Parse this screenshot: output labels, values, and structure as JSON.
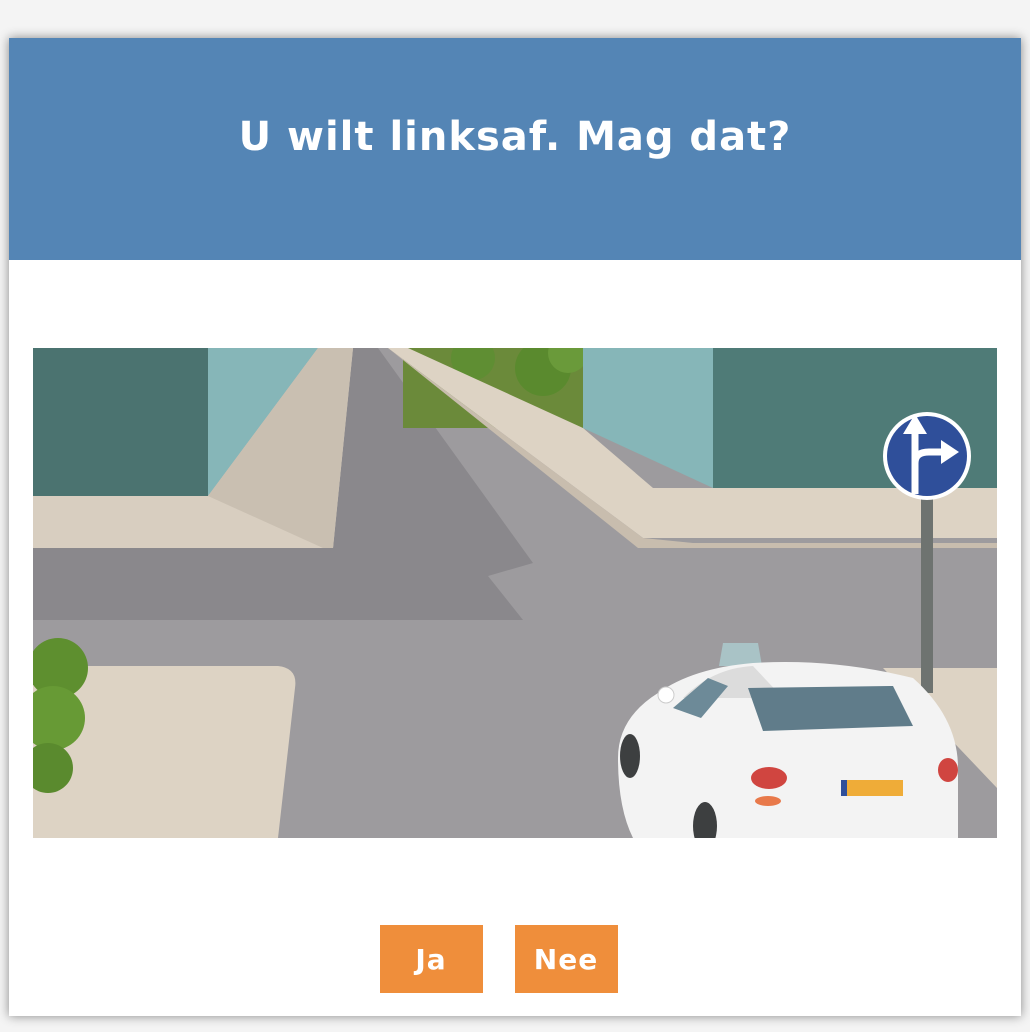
{
  "question": {
    "title": "U wilt linksaf. Mag dat?"
  },
  "answers": {
    "yes_label": "Ja",
    "no_label": "Nee"
  },
  "colors": {
    "header": "#5485b5",
    "button": "#ef8e3b",
    "sign": "#2f4f9a"
  },
  "illustration": {
    "sign_icon": "straight-or-right-arrow-icon"
  }
}
